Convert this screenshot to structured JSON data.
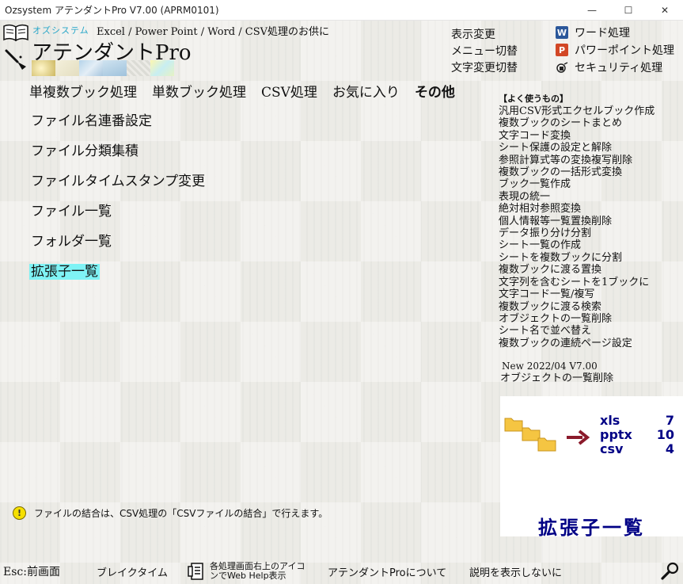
{
  "window": {
    "title": "Ozsystem アテンダントPro V7.00 (APRM0101)",
    "min_glyph": "—",
    "max_glyph": "☐",
    "close_glyph": "✕"
  },
  "header": {
    "brand_label": "オズシステム",
    "brand_desc": "Excel / Power Point / Word / CSV処理のお供に",
    "app_name": "アテンダントPro"
  },
  "top_menu": {
    "items": [
      "表示変更",
      "メニュー切替",
      "文字変更切替"
    ]
  },
  "apps": {
    "word": {
      "label": "ワード処理",
      "icon": "W"
    },
    "ppt": {
      "label": "パワーポイント処理",
      "icon": "P"
    },
    "security": {
      "label": "セキュリティ処理"
    }
  },
  "tabs": [
    "単複数ブック処理",
    "単数ブック処理",
    "CSV処理",
    "お気に入り",
    "その他"
  ],
  "active_tab": "その他",
  "functions": [
    "ファイル名連番設定",
    "ファイル分類集積",
    "ファイルタイムスタンプ変更",
    "ファイル一覧",
    "フォルダ一覧",
    "拡張子一覧"
  ],
  "selected_function": "拡張子一覧",
  "often_used": {
    "heading": "【よく使うもの】",
    "items": [
      "汎用CSV形式エクセルブック作成",
      "複数ブックのシートまとめ",
      "文字コード変換",
      "シート保護の設定と解除",
      "参照計算式等の変換複写削除",
      "複数ブックの一括形式変換",
      "ブック一覧作成",
      "表現の統一",
      "絶対相対参照変換",
      "個人情報等一覧置換削除",
      "データ振り分け分割",
      "シート一覧の作成",
      "シートを複数ブックに分割",
      "複数ブックに渡る置換",
      "文字列を含むシートを1ブックに",
      "文字コード一覧/複写",
      "複数ブックに渡る検索",
      "オブジェクトの一覧削除",
      "シート名で並べ替え",
      "複数ブックの連続ページ設定"
    ]
  },
  "news": {
    "line1": "New 2022/04 V7.00",
    "line2": "オブジェクトの一覧削除"
  },
  "preview": {
    "title": "拡張子一覧",
    "rows": [
      {
        "ext": "xls",
        "count": "7"
      },
      {
        "ext": "pptx",
        "count": "10"
      },
      {
        "ext": "csv",
        "count": "4"
      }
    ]
  },
  "hint": {
    "icon": "!",
    "text": "ファイルの結合は、CSV処理の「CSVファイルの結合」で行えます。"
  },
  "bottom": {
    "esc": "Esc:前画面",
    "break": "ブレイクタイム",
    "webhelp": "各処理画面右上のアイコンでWeb Help表示",
    "about": "アテンダントProについて",
    "hide_desc": "説明を表示しないに"
  },
  "colors": {
    "selected_highlight": "#7ff3f5",
    "accent_navy": "#000085",
    "folder_yellow": "#f5c542",
    "arrow_red": "#8b1a2b"
  }
}
